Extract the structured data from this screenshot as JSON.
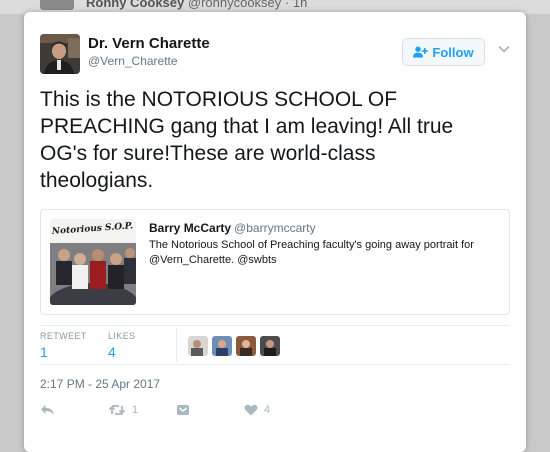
{
  "background": {
    "name": "Ronny Cooksey",
    "meta": "@ronnycooksey · 1h"
  },
  "tweet": {
    "author_name": "Dr. Vern Charette",
    "author_handle": "@Vern_Charette",
    "follow_label": "Follow",
    "text": "This is the NOTORIOUS SCHOOL OF PREACHING gang that I am leaving! All true OG's for sure!These are world-class theologians.",
    "quoted": {
      "author_name": "Barry McCarty",
      "author_handle": "@barrymccarty",
      "text": "The Notorious School of Preaching faculty's going away portrait for @Vern_Charette. @swbts",
      "image_caption": "Notorious S.O.P."
    },
    "stats": {
      "retweets_label": "RETWEET",
      "retweets": "1",
      "likes_label": "LIKES",
      "likes": "4"
    },
    "timestamp": "2:17 PM - 25 Apr 2017",
    "actions": {
      "reply_icon": "reply-icon",
      "retweet_icon": "retweet-icon",
      "retweet_count": "1",
      "dm_icon": "direct-message-icon",
      "like_icon": "heart-icon",
      "like_count": "4"
    }
  },
  "colors": {
    "accent": "#1da1f2",
    "muted": "#657786",
    "text": "#14171a"
  }
}
